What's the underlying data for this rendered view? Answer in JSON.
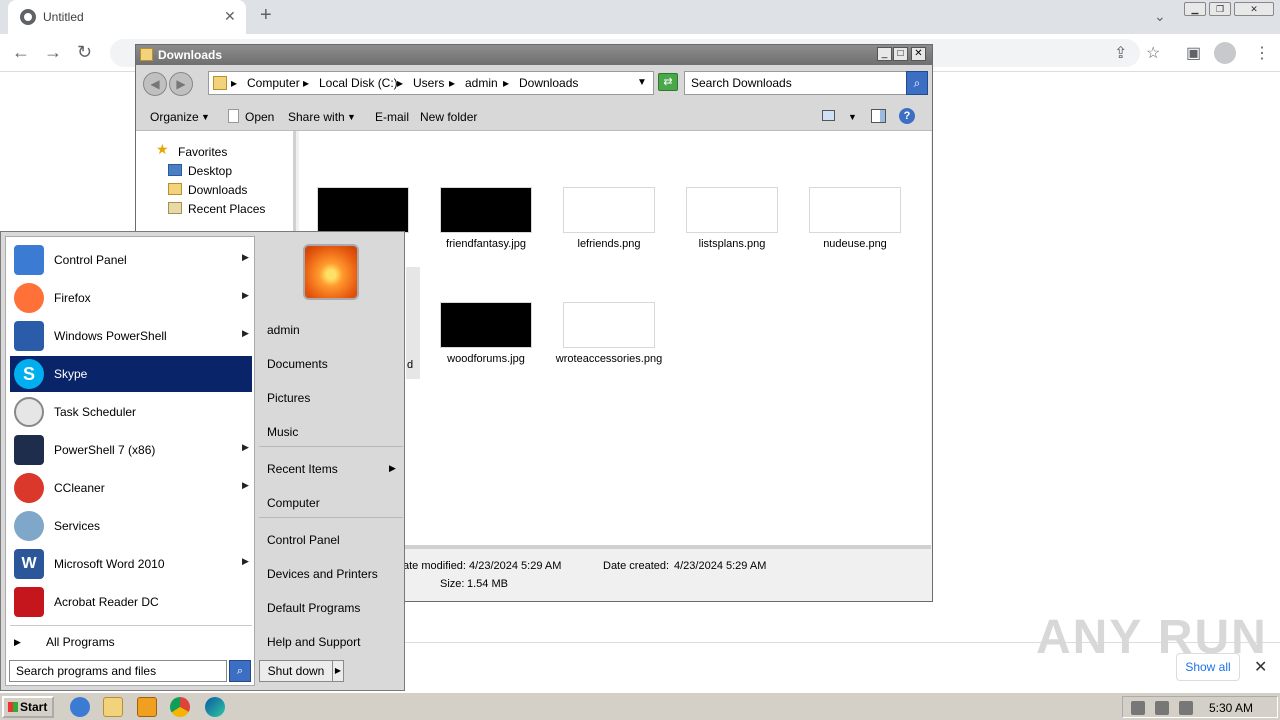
{
  "browser": {
    "tab_title": "Untitled",
    "tab_close": "✕",
    "new_tab": "+",
    "tab_dropdown": "⌄",
    "back": "←",
    "forward": "→",
    "reload": "↻"
  },
  "explorer": {
    "title": "Downloads",
    "breadcrumb": [
      "Computer",
      "Local Disk (C:)",
      "Users",
      "admin",
      "Downloads"
    ],
    "search_placeholder": "Search Downloads",
    "commands": [
      "Organize",
      "Open",
      "Share with",
      "E-mail",
      "New folder"
    ],
    "nav": {
      "favorites": "Favorites",
      "items": [
        "Desktop",
        "Downloads",
        "Recent Places"
      ]
    },
    "files": [
      {
        "name": "friendfantasy.jpg",
        "thumb": "dark"
      },
      {
        "name": "lefriends.png",
        "thumb": "light"
      },
      {
        "name": "listsplans.png",
        "thumb": "light"
      },
      {
        "name": "nudeuse.png",
        "thumb": "light"
      },
      {
        "name": "woodforums.jpg",
        "thumb": "dark"
      },
      {
        "name": "wroteaccessories.png",
        "thumb": "light"
      }
    ],
    "partial_file_suffix": "d",
    "details": {
      "date_modified": "ate modified: 4/23/2024 5:29 AM",
      "date_created_label": "Date created:",
      "date_created": "4/23/2024 5:29 AM",
      "size_label": "Size:",
      "size": "1.54 MB"
    }
  },
  "start_menu": {
    "programs": [
      {
        "label": "Control Panel",
        "arrow": true,
        "color": "#3b7bd4"
      },
      {
        "label": "Firefox",
        "arrow": true,
        "color": "#ff7139"
      },
      {
        "label": "Windows PowerShell",
        "arrow": true,
        "color": "#2a5caa"
      },
      {
        "label": "Skype",
        "arrow": false,
        "color": "#00aff0"
      },
      {
        "label": "Task Scheduler",
        "arrow": false,
        "color": "#c9c9c9"
      },
      {
        "label": "PowerShell 7 (x86)",
        "arrow": true,
        "color": "#1f2d4d"
      },
      {
        "label": "CCleaner",
        "arrow": true,
        "color": "#d9382a"
      },
      {
        "label": "Services",
        "arrow": false,
        "color": "#7fa7c9"
      },
      {
        "label": "Microsoft Word 2010",
        "arrow": true,
        "color": "#2b579a"
      },
      {
        "label": "Acrobat Reader DC",
        "arrow": false,
        "color": "#c4161c"
      }
    ],
    "all_programs": "All Programs",
    "search_placeholder": "Search programs and files",
    "right": [
      "admin",
      "Documents",
      "Pictures",
      "Music",
      "Recent Items",
      "Computer",
      "Control Panel",
      "Devices and Printers",
      "Default Programs",
      "Help and Support"
    ],
    "shutdown": "Shut down"
  },
  "download_bar": {
    "show_all": "Show all"
  },
  "watermark": "ANY RUN",
  "taskbar": {
    "start": "Start",
    "clock": "5:30 AM"
  }
}
